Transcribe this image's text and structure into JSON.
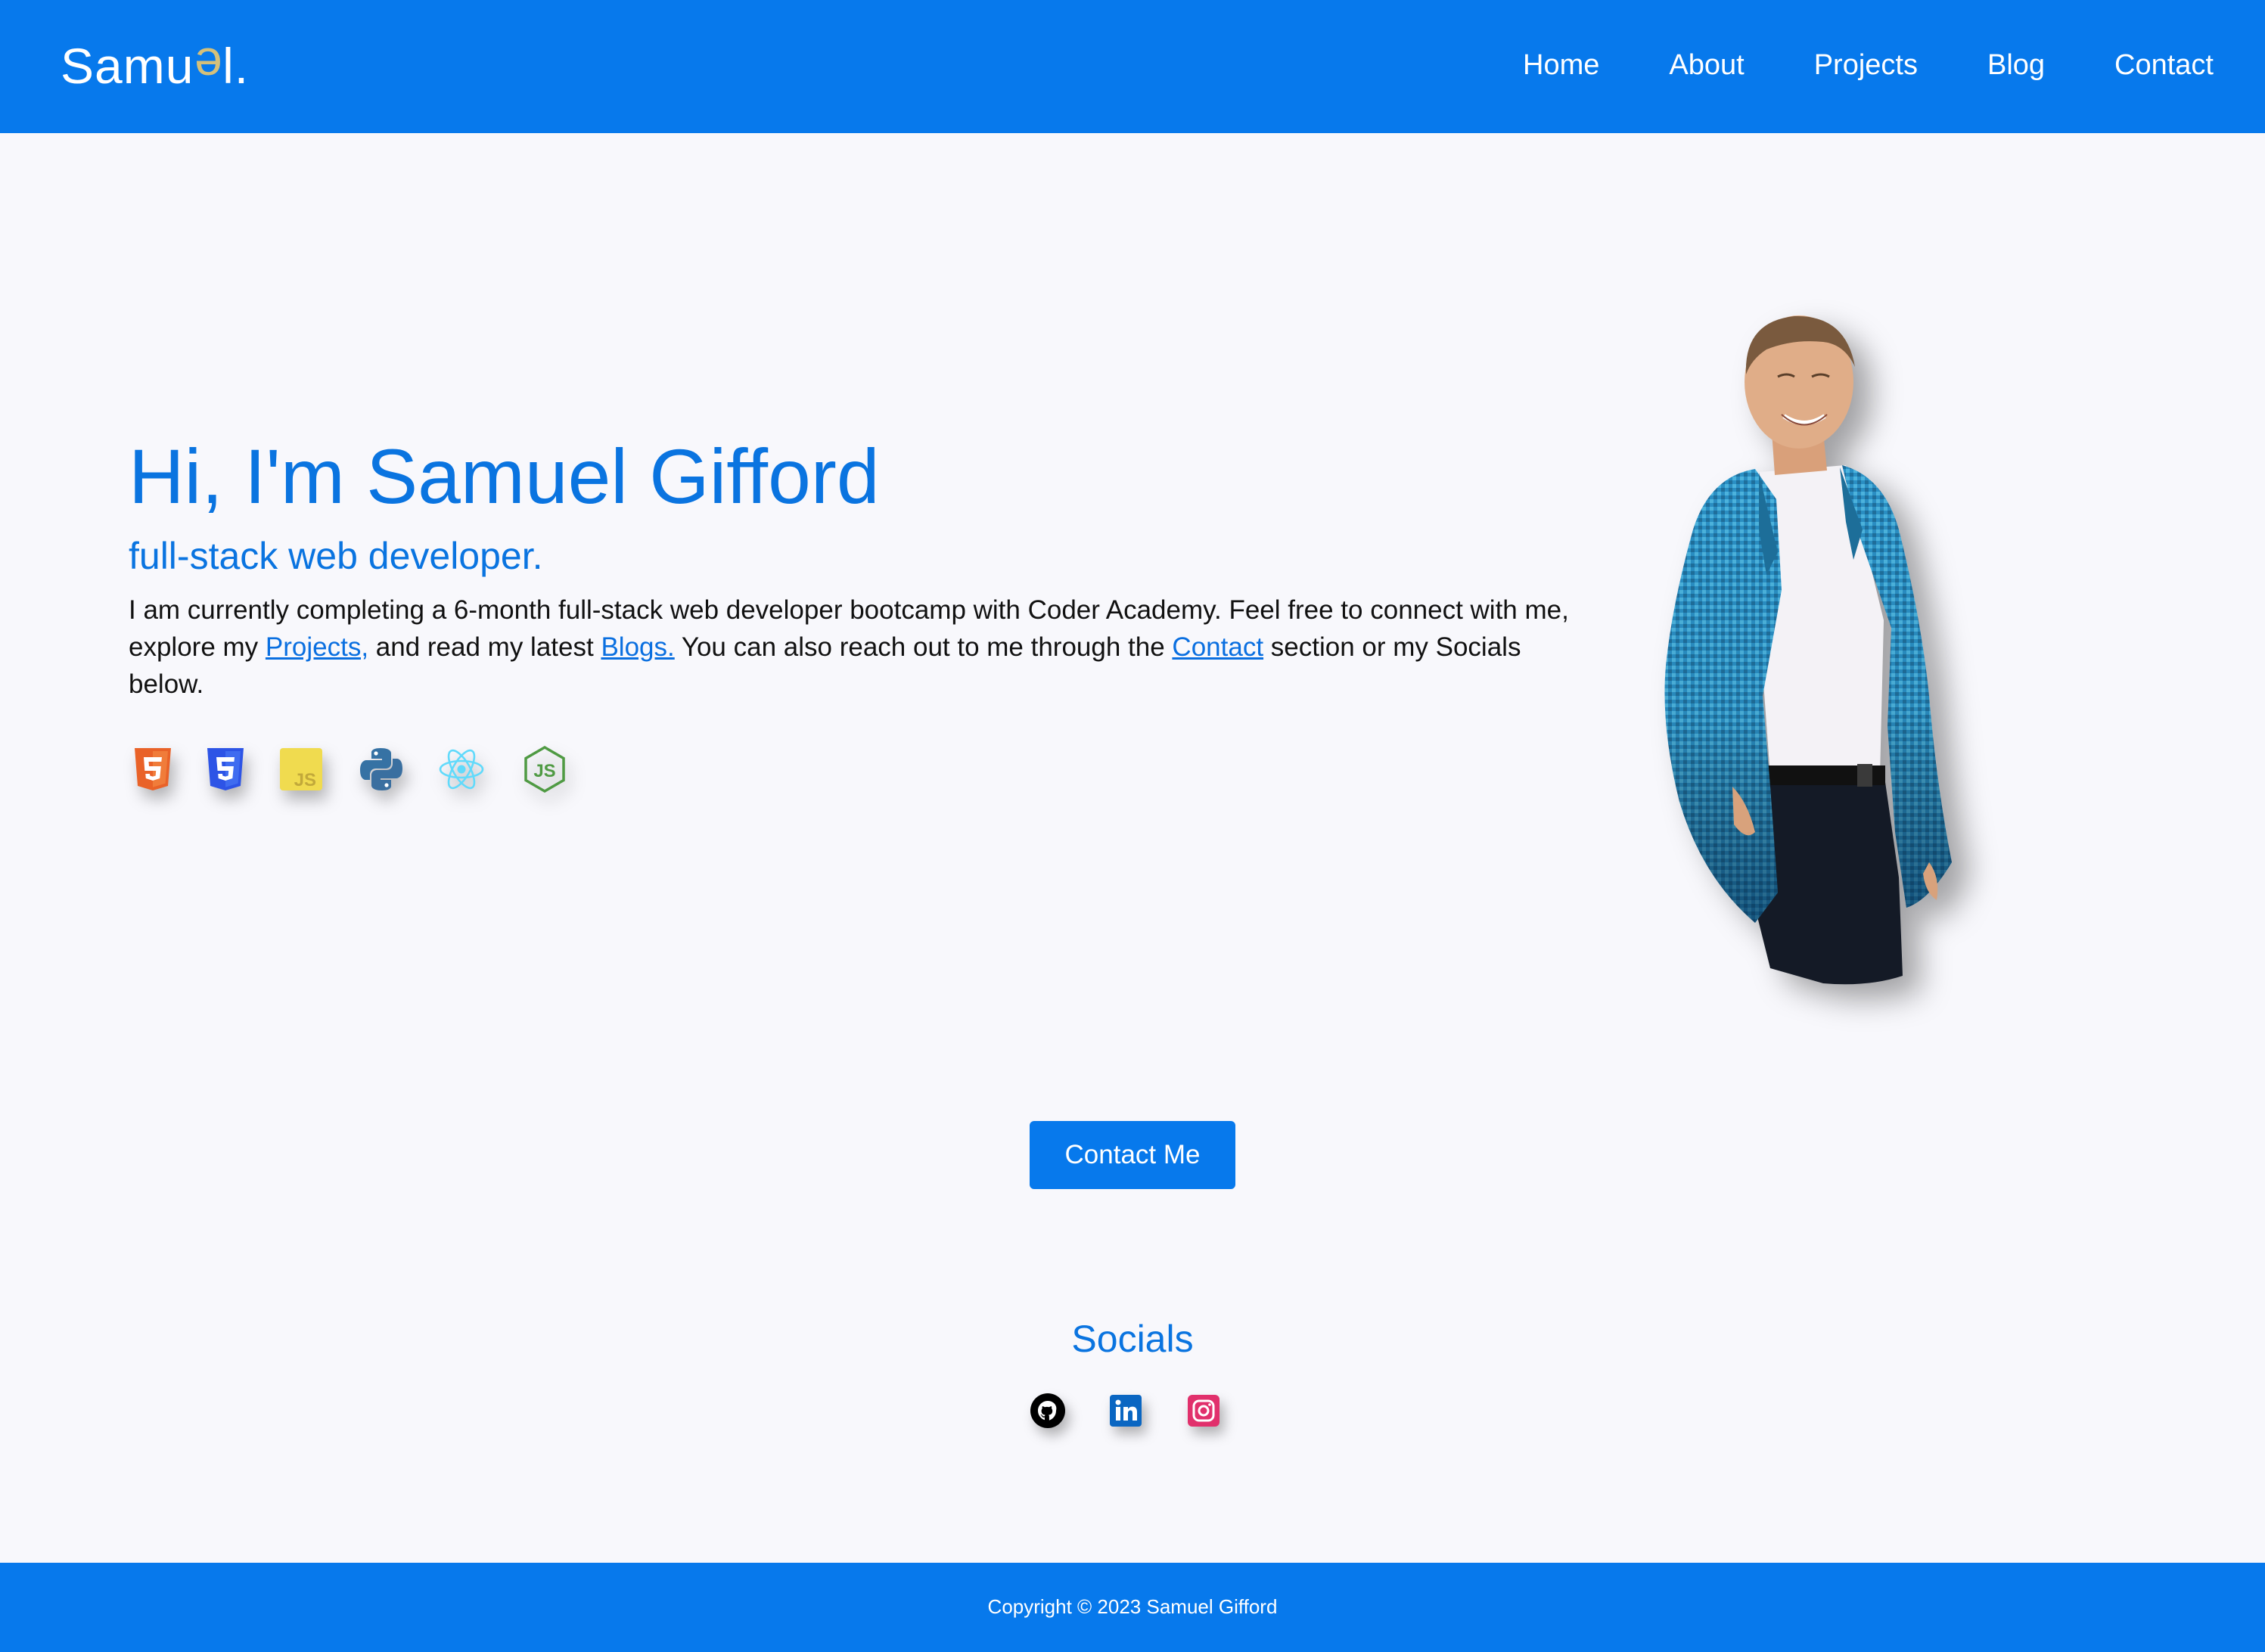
{
  "navbar": {
    "brand": {
      "prefix": "Samu",
      "flipped": "e",
      "suffix": "l."
    },
    "links": [
      "Home",
      "About",
      "Projects",
      "Blog",
      "Contact"
    ]
  },
  "hero": {
    "title": "Hi, I'm Samuel Gifford",
    "subtitle": "full-stack web developer.",
    "intro": {
      "part1": "I am currently completing a 6-month full-stack web developer bootcamp with Coder Academy. Feel free to connect with me, explore my ",
      "projects_link": "Projects,",
      "part2": " and read my latest ",
      "blogs_link": "Blogs.",
      "part3": " You can also reach out to me through the ",
      "contact_link": "Contact",
      "part4": " section or my Socials below."
    },
    "tech_icons": [
      "html5-icon",
      "css3-icon",
      "javascript-icon",
      "python-icon",
      "react-icon",
      "nodejs-icon"
    ]
  },
  "contact_button": {
    "label": "Contact Me"
  },
  "socials": {
    "title": "Socials",
    "icons": [
      "github-icon",
      "linkedin-icon",
      "instagram-icon"
    ]
  },
  "footer": {
    "copyright": "Copyright © 2023 Samuel Gifford"
  },
  "colors": {
    "primary": "#0779ec",
    "heading": "#0a74e0",
    "background": "#f8f8fc",
    "html5": "#e96228",
    "css3": "#2d54e6",
    "javascript": "#f0db4f",
    "python_blue": "#3672a4",
    "python_yellow": "#ffd43b",
    "react": "#61dafb",
    "nodejs": "#4f9a43",
    "github": "#000000",
    "linkedin": "#0a66c2",
    "instagram": "#e1306c"
  }
}
